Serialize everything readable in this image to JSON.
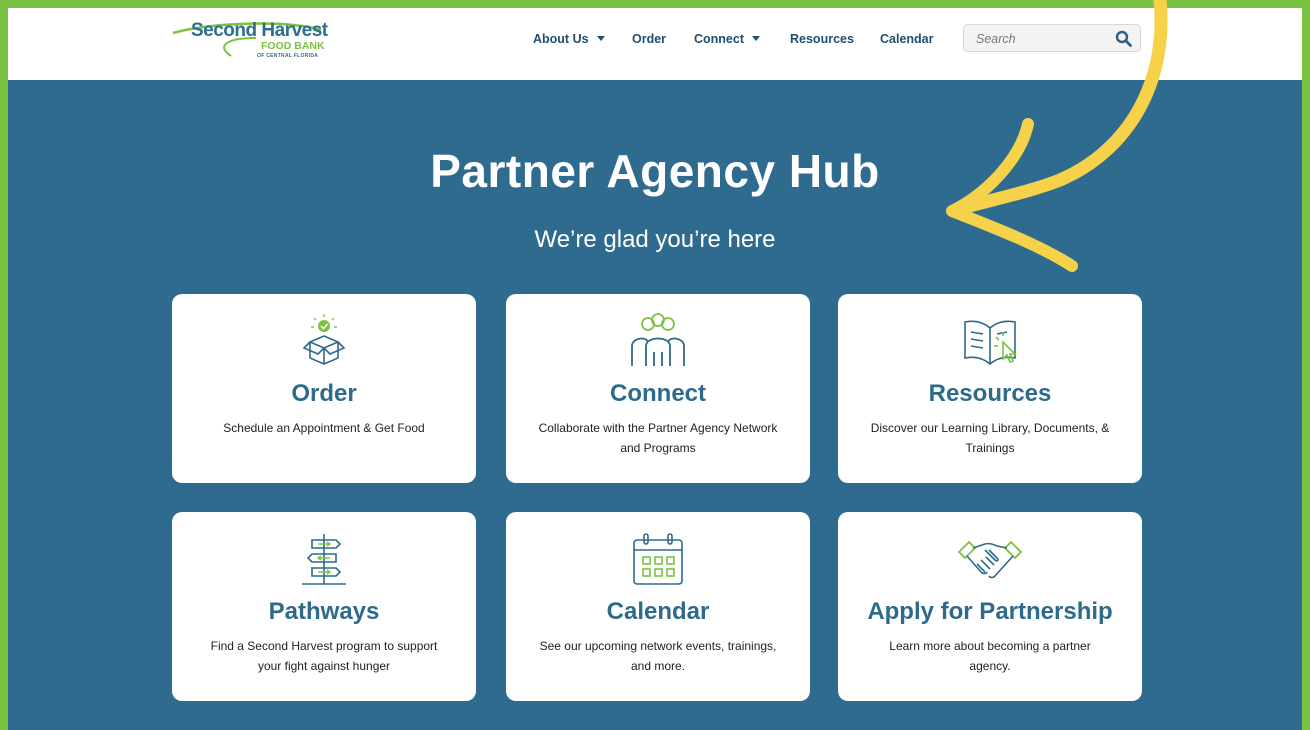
{
  "logo": {
    "line1": "Second Harvest",
    "line2": "FOOD BANK",
    "line3": "OF CENTRAL FLORIDA"
  },
  "nav": {
    "items": [
      {
        "label": "About Us",
        "dropdown": true
      },
      {
        "label": "Order",
        "dropdown": false
      },
      {
        "label": "Connect",
        "dropdown": true
      },
      {
        "label": "Resources",
        "dropdown": false
      },
      {
        "label": "Calendar",
        "dropdown": false
      }
    ]
  },
  "search": {
    "placeholder": "Search",
    "icon": "search-icon"
  },
  "hero": {
    "title": "Partner Agency Hub",
    "subtitle": "We’re glad you’re here"
  },
  "cards": [
    {
      "title": "Order",
      "description": "Schedule an Appointment & Get Food",
      "icon": "box-icon"
    },
    {
      "title": "Connect",
      "description": "Collaborate with the Partner Agency Network and Programs",
      "icon": "people-icon"
    },
    {
      "title": "Resources",
      "description": "Discover our Learning Library, Documents, & Trainings",
      "icon": "book-icon"
    },
    {
      "title": "Pathways",
      "description": "Find a Second Harvest program to support your fight against hunger",
      "icon": "signpost-icon"
    },
    {
      "title": "Calendar",
      "description": "See our upcoming network events, trainings, and more.",
      "icon": "calendar-icon"
    },
    {
      "title": "Apply for Partnership",
      "description": "Learn more about becoming a partner agency.",
      "icon": "handshake-icon"
    }
  ],
  "colors": {
    "frame_green": "#7cc242",
    "hero_blue": "#2f6b8f",
    "title_blue": "#2e6a8c",
    "arrow_yellow": "#f6d24a"
  }
}
